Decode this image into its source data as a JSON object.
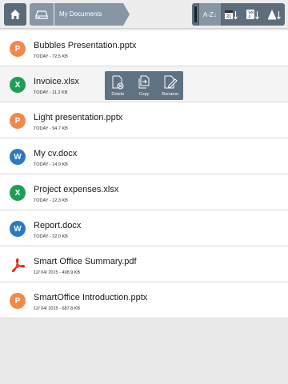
{
  "toolbar": {
    "home_icon": "home-icon",
    "breadcrumb": {
      "drive_icon": "drive-icon",
      "folder_label": "My Documents"
    },
    "sort": {
      "items": [
        {
          "label": "A-Z",
          "icon": "sort-alpha-icon"
        },
        {
          "label": "31",
          "icon": "sort-date-icon"
        },
        {
          "label": "W X P",
          "icon": "sort-type-icon"
        },
        {
          "label": "",
          "icon": "sort-size-icon"
        }
      ],
      "active_index": 0
    }
  },
  "files": [
    {
      "name": "Bubbles Presentation.pptx",
      "meta": "TODAY - 72.5 KB",
      "type": "P",
      "color": "#f08a4b"
    },
    {
      "name": "Invoice.xlsx",
      "meta": "TODAY - 11.2 KB",
      "type": "X",
      "color": "#1e9e55"
    },
    {
      "name": "Light presentation.pptx",
      "meta": "TODAY - 94.7 KB",
      "type": "P",
      "color": "#f08a4b"
    },
    {
      "name": "My cv.docx",
      "meta": "TODAY - 14.9 KB",
      "type": "W",
      "color": "#2b79c2"
    },
    {
      "name": "Project expenses.xlsx",
      "meta": "TODAY - 12.3 KB",
      "type": "X",
      "color": "#1e9e55"
    },
    {
      "name": "Report.docx",
      "meta": "TODAY - 22.0 KB",
      "type": "W",
      "color": "#2b79c2"
    },
    {
      "name": "Smart Office Summary.pdf",
      "meta": "12/ 04/ 2015 - 498.9 KB",
      "type": "pdf",
      "color": "#d9331f"
    },
    {
      "name": "SmartOffice Introduction.pptx",
      "meta": "12/ 04/ 2015 - 687.8 KB",
      "type": "P",
      "color": "#f08a4b"
    }
  ],
  "context_menu": {
    "delete_label": "Delete",
    "copy_label": "Copy",
    "rename_label": "Rename"
  }
}
